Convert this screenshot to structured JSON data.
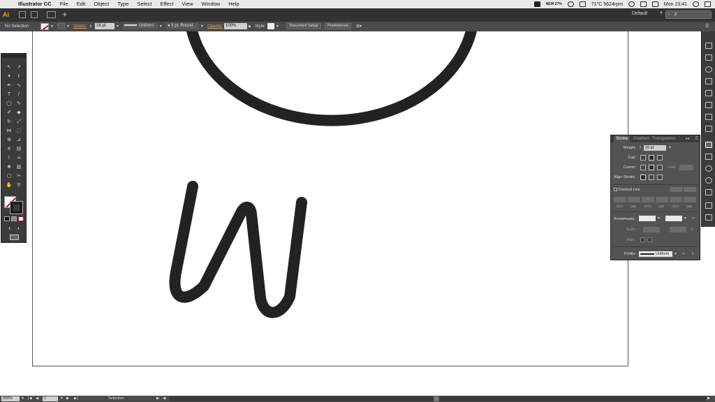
{
  "menubar": {
    "app_name": "Illustrator CC",
    "menus": [
      "File",
      "Edit",
      "Object",
      "Type",
      "Select",
      "Effect",
      "View",
      "Window",
      "Help"
    ],
    "status": {
      "battery_text": "NEW 27%",
      "temperature": "71°C 5624rpm",
      "clock": "Mon 23:41"
    }
  },
  "appbar": {
    "logo": "Ai",
    "workspace": "Default",
    "search_value": "z"
  },
  "controlbar": {
    "selection": "No Selection",
    "stroke_label": "Stroke:",
    "stroke_weight": "16 pt",
    "profile": "Uniform",
    "brush": "5 pt. Round",
    "opacity_label": "Opacity:",
    "opacity_value": "100%",
    "style_label": "Style:",
    "document_setup": "Document Setup",
    "preferences": "Preferences"
  },
  "stroke_panel": {
    "tabs": [
      "Stroke",
      "Gradient",
      "Transparenc"
    ],
    "weight_label": "Weight:",
    "weight_value": "16 pt",
    "cap_label": "Cap:",
    "corner_label": "Corner:",
    "limit_label": "Limit:",
    "align_label": "Align Stroke:",
    "dashed_label": "Dashed Line",
    "dash_labels": [
      "dash",
      "gap",
      "dash",
      "gap",
      "dash",
      "gap"
    ],
    "arrowheads_label": "Arrowheads:",
    "scale_label": "Scale:",
    "align2_label": "Align:",
    "profile_label": "Profile:",
    "profile_value": "Uniform"
  },
  "statusbar": {
    "zoom": "200%",
    "artboard": "1",
    "mode": "Selection"
  },
  "colors": {
    "ai_orange": "#ff9a00",
    "stroke_black": "#222222"
  },
  "icons": {
    "tools": [
      "selection-tool",
      "direct-selection-tool",
      "magic-wand-tool",
      "lasso-tool",
      "pen-tool",
      "curvature-tool",
      "type-tool",
      "line-tool",
      "ellipse-tool",
      "paintbrush-tool",
      "shaper-tool",
      "eraser-tool",
      "rotate-tool",
      "scale-tool",
      "width-tool",
      "free-transform-tool",
      "shape-builder-tool",
      "perspective-grid-tool",
      "mesh-tool",
      "gradient-tool",
      "eyedropper-tool",
      "blend-tool",
      "symbol-sprayer-tool",
      "column-graph-tool",
      "artboard-tool",
      "slice-tool",
      "hand-tool",
      "zoom-tool"
    ]
  }
}
